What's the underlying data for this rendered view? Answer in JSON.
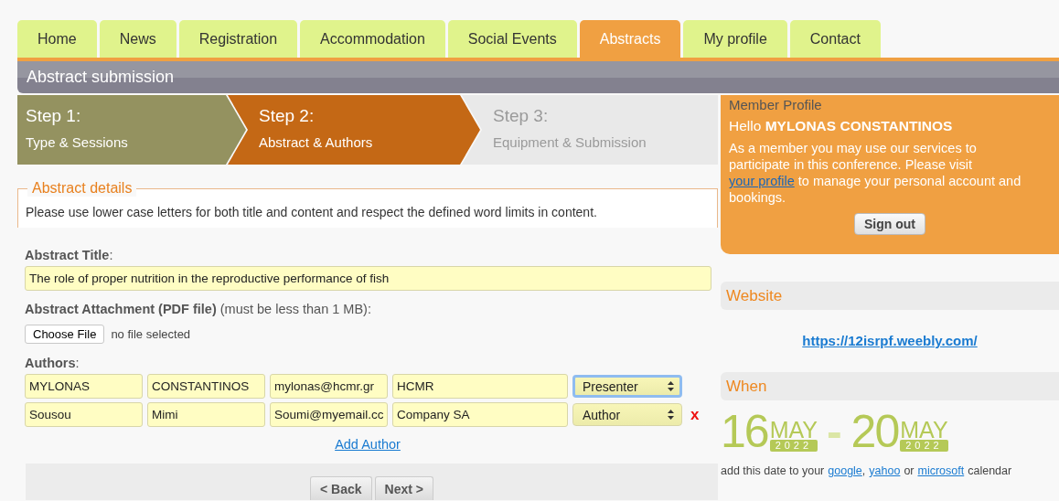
{
  "tabs": [
    {
      "label": "Home",
      "selected": false
    },
    {
      "label": "News",
      "selected": false
    },
    {
      "label": "Registration",
      "selected": false
    },
    {
      "label": "Accommodation",
      "selected": false
    },
    {
      "label": "Social Events",
      "selected": false
    },
    {
      "label": "Abstracts",
      "selected": true
    },
    {
      "label": "My profile",
      "selected": false
    },
    {
      "label": "Contact",
      "selected": false
    }
  ],
  "page_title": "Abstract submission",
  "steps": [
    {
      "number": "Step 1:",
      "label": "Type & Sessions",
      "kind": "done"
    },
    {
      "number": "Step 2:",
      "label": "Abstract & Authors",
      "kind": "current"
    },
    {
      "number": "Step 3:",
      "label": "Equipment & Submission",
      "kind": "upcoming"
    }
  ],
  "details": {
    "legend": "Abstract details",
    "note": "Please use lower case letters for both title and content and respect the defined word limits in content."
  },
  "title_field": {
    "label": "**Abstract Title**:",
    "value": "The role of proper nutrition in the reproductive performance of fish"
  },
  "attachment": {
    "label": "**Abstract Attachment (PDF file)** (must be less than 1 MB):",
    "button": "Choose File",
    "status": "no file selected"
  },
  "authors": {
    "label": "**Authors**:",
    "rows": [
      {
        "last_name": "MYLONAS",
        "first_name": "CONSTANTINOS",
        "email": "mylonas@hcmr.gr",
        "affiliation": "HCMR",
        "role": "Presenter",
        "focused": true,
        "removable": false
      },
      {
        "last_name": "Sousou",
        "first_name": "Mimi",
        "email": "Soumi@myemail.cc",
        "affiliation": "Company SA",
        "role": "Author",
        "focused": false,
        "removable": true
      }
    ],
    "remove_label": "x",
    "add": "Add Author"
  },
  "nav_buttons": [
    "< Back",
    "Next >"
  ],
  "member": {
    "heading": "Member Profile",
    "greeting": "Hello **MYLONAS CONSTANTINOS**",
    "text_before": "As a member you may use our services to participate in this conference. Please visit ",
    "link": "your profile",
    "text_after": " to manage your personal account and bookings.",
    "button": "Sign out"
  },
  "website": {
    "heading": "Website",
    "link": "https://12isrpf.weebly.com/"
  },
  "when": {
    "heading": "When",
    "start": {
      "day": "16",
      "month": "MAY",
      "year": "2022"
    },
    "separator": "-",
    "end": {
      "day": "20",
      "month": "MAY",
      "year": "2022"
    },
    "calendar": [
      {
        "kind": "text",
        "text": "add this date to your"
      },
      {
        "kind": "link",
        "text": "google"
      },
      {
        "kind": "text",
        "text": ","
      },
      {
        "kind": "link",
        "text": "yahoo"
      },
      {
        "kind": "text",
        "text": "or"
      },
      {
        "kind": "link",
        "text": "microsoft"
      },
      {
        "kind": "text",
        "text": "calendar"
      }
    ]
  }
}
